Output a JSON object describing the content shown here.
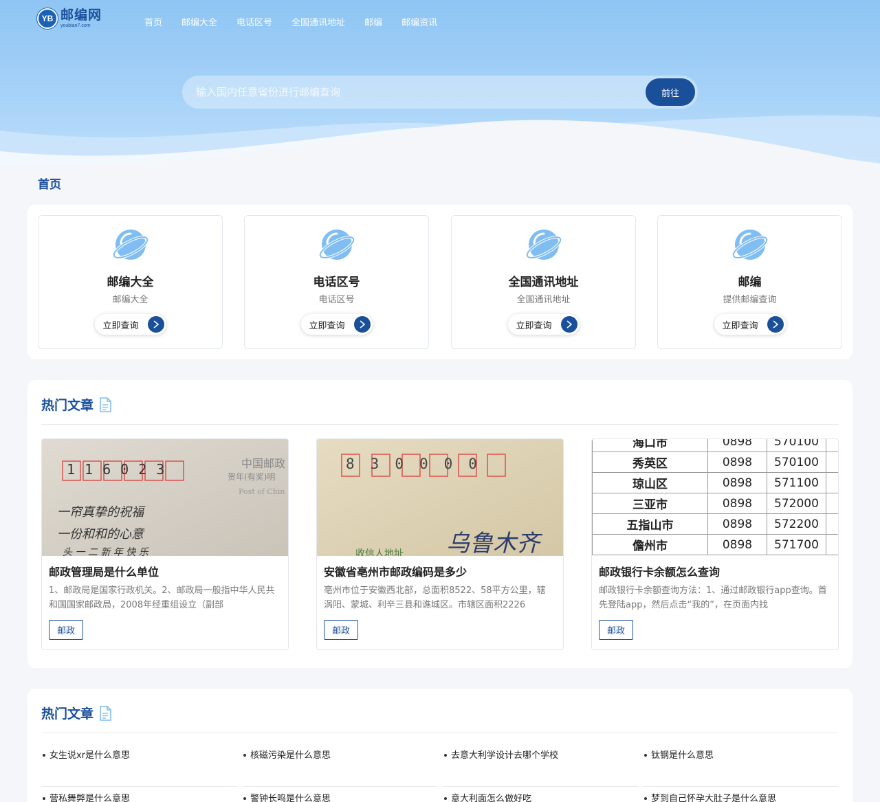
{
  "site": {
    "logo_mark": "YB",
    "logo_title": "邮编网",
    "logo_sub": "youbian7.com"
  },
  "nav": {
    "items": [
      {
        "label": "首页"
      },
      {
        "label": "邮编大全"
      },
      {
        "label": "电话区号"
      },
      {
        "label": "全国通讯地址"
      },
      {
        "label": "邮编"
      },
      {
        "label": "邮编资讯"
      }
    ]
  },
  "search": {
    "placeholder": "输入国内任意省份进行邮编查询",
    "button": "前往"
  },
  "breadcrumb": "首页",
  "features": [
    {
      "title": "邮编大全",
      "desc": "邮编大全",
      "button": "立即查询"
    },
    {
      "title": "电话区号",
      "desc": "电话区号",
      "button": "立即查询"
    },
    {
      "title": "全国通讯地址",
      "desc": "全国通讯地址",
      "button": "立即查询"
    },
    {
      "title": "邮编",
      "desc": "提供邮编查询",
      "button": "立即查询"
    }
  ],
  "hot1": {
    "title": "热门文章",
    "articles": [
      {
        "title": "邮政管理局是什么单位",
        "summary": "1、邮政局是国家行政机关。2、邮政局一般指中华人民共和国国家邮政局，2008年经重组设立（副部",
        "tag": "邮政",
        "image": {
          "digits": [
            "1",
            "1",
            "6",
            "0",
            "2",
            "3"
          ],
          "stamp_line1": "中国邮政",
          "stamp_line2": "贺年(有奖)明",
          "stamp_line3": "Post of Chin",
          "hand1": "一帘真挚的祝福",
          "hand2": "一份和和的心意",
          "hand3": "头 一 二 新 年 快 乐"
        }
      },
      {
        "title": "安徽省亳州市邮政编码是多少",
        "summary": "亳州市位于安徽西北部，总面积8522、58平方公里，辖涡阳、蒙城、利辛三县和谯城区。市辖区面积2226",
        "tag": "邮政",
        "image": {
          "digits": [
            "8",
            "3",
            "0",
            "0",
            "0",
            "0"
          ],
          "hand1": "乌鲁木齐",
          "hand2": "收信人地址"
        }
      },
      {
        "title": "邮政银行卡余额怎么查询",
        "summary": "邮政银行卡余额查询方法：1、通过邮政银行app查询。首先登陆app，然后点击“我的”，在页面内找",
        "tag": "邮政",
        "image": {
          "rows": [
            {
              "name": "海口市",
              "code": "0898",
              "zip": "570100"
            },
            {
              "name": "秀英区",
              "code": "0898",
              "zip": "570100"
            },
            {
              "name": "琼山区",
              "code": "0898",
              "zip": "571100"
            },
            {
              "name": "三亚市",
              "code": "0898",
              "zip": "572000"
            },
            {
              "name": "五指山市",
              "code": "0898",
              "zip": "572200"
            },
            {
              "name": "儋州市",
              "code": "0898",
              "zip": "571700"
            }
          ]
        }
      }
    ]
  },
  "hot2": {
    "title": "热门文章",
    "columns": [
      [
        "女生说xr是什么意思",
        "营私舞弊是什么意思"
      ],
      [
        "核磁污染是什么意思",
        "警钟长鸣是什么意思"
      ],
      [
        "去意大利学设计去哪个学校",
        "意大利面怎么做好吃"
      ],
      [
        "钛钢是什么意思",
        "梦到自己怀孕大肚子是什么意思"
      ]
    ]
  },
  "colors": {
    "primary": "#1a4f9a",
    "hero_top": "#8ec5f4",
    "icon_blue": "#7fbdf2"
  }
}
